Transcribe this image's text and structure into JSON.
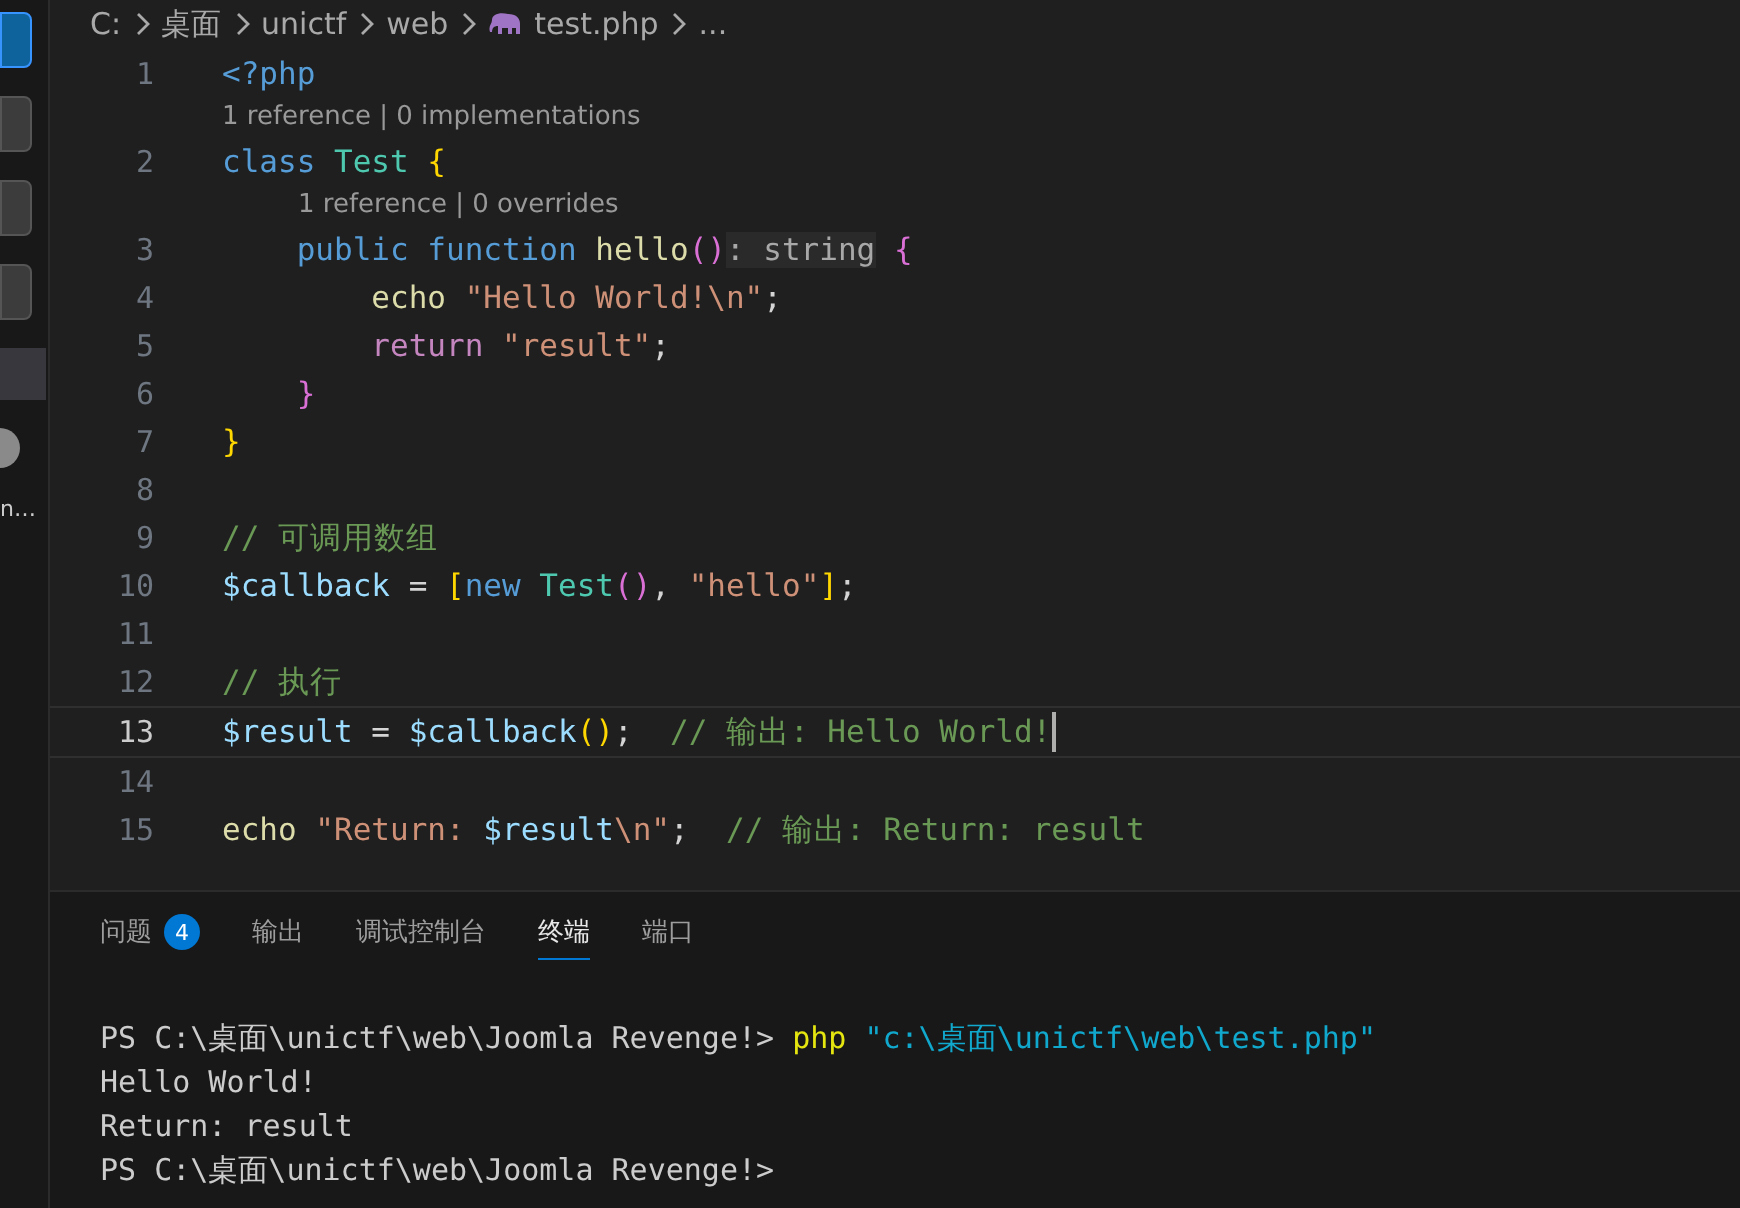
{
  "activity_bar": {
    "items": [
      {
        "kind": "icon",
        "selected": true
      },
      {
        "kind": "icon",
        "selected": false
      },
      {
        "kind": "icon",
        "selected": false
      },
      {
        "kind": "icon",
        "selected": false
      },
      {
        "kind": "highlight",
        "selected": true
      },
      {
        "kind": "dot",
        "selected": false
      }
    ],
    "cut_label": "n…"
  },
  "breadcrumb": [
    "C:",
    "桌面",
    "unictf",
    "web",
    "test.php",
    "..."
  ],
  "editor": {
    "lines": [
      {
        "number": "1",
        "current": false,
        "tokens": [
          {
            "text": "<?php",
            "kind": "keyword"
          }
        ]
      },
      {
        "number": "2",
        "current": false,
        "lens": "1 reference | 0 implementations",
        "tokens": [
          {
            "text": "class ",
            "kind": "keyword"
          },
          {
            "text": "Test ",
            "kind": "type"
          },
          {
            "text": "{",
            "kind": "bracket1"
          }
        ]
      },
      {
        "number": "3",
        "current": false,
        "lens": "1 reference | 0 overrides",
        "tokens": [
          {
            "text": "    public function ",
            "kind": "keyword"
          },
          {
            "text": "hello",
            "kind": "function"
          },
          {
            "text": "()",
            "kind": "bracket2"
          },
          {
            "text": ": string",
            "kind": "hint"
          },
          {
            "text": " {",
            "kind": "bracket2"
          }
        ]
      },
      {
        "number": "4",
        "current": false,
        "tokens": [
          {
            "text": "        echo ",
            "kind": "function"
          },
          {
            "text": "\"Hello World!\\n\"",
            "kind": "string"
          },
          {
            "text": ";",
            "kind": "plain"
          }
        ]
      },
      {
        "number": "5",
        "current": false,
        "tokens": [
          {
            "text": "        return ",
            "kind": "control"
          },
          {
            "text": "\"result\"",
            "kind": "string"
          },
          {
            "text": ";",
            "kind": "plain"
          }
        ]
      },
      {
        "number": "6",
        "current": false,
        "tokens": [
          {
            "text": "    }",
            "kind": "bracket2"
          }
        ]
      },
      {
        "number": "7",
        "current": false,
        "tokens": [
          {
            "text": "}",
            "kind": "bracket1"
          }
        ]
      },
      {
        "number": "8",
        "current": false
      },
      {
        "number": "9",
        "current": false,
        "tokens": [
          {
            "text": "// 可调用数组",
            "kind": "comment"
          }
        ]
      },
      {
        "number": "10",
        "current": false,
        "tokens": [
          {
            "text": "$callback",
            "kind": "variable"
          },
          {
            "text": " = ",
            "kind": "plain"
          },
          {
            "text": "[",
            "kind": "bracket1"
          },
          {
            "text": "new ",
            "kind": "keyword"
          },
          {
            "text": "Test",
            "kind": "type"
          },
          {
            "text": "()",
            "kind": "bracket2"
          },
          {
            "text": ", ",
            "kind": "plain"
          },
          {
            "text": "\"hello\"",
            "kind": "string"
          },
          {
            "text": "]",
            "kind": "bracket1"
          },
          {
            "text": ";",
            "kind": "plain"
          }
        ]
      },
      {
        "number": "11",
        "current": false
      },
      {
        "number": "12",
        "current": false,
        "tokens": [
          {
            "text": "// 执行",
            "kind": "comment"
          }
        ]
      },
      {
        "number": "13",
        "current": true,
        "tokens": [
          {
            "text": "$result",
            "kind": "variable"
          },
          {
            "text": " = ",
            "kind": "plain"
          },
          {
            "text": "$callback",
            "kind": "variable"
          },
          {
            "text": "()",
            "kind": "bracket1"
          },
          {
            "text": ";  ",
            "kind": "plain"
          },
          {
            "text": "// 输出: Hello World!",
            "kind": "comment"
          }
        ]
      },
      {
        "number": "14",
        "current": false
      },
      {
        "number": "15",
        "current": false,
        "tokens": [
          {
            "text": "echo ",
            "kind": "function"
          },
          {
            "text": "\"Return: ",
            "kind": "string"
          },
          {
            "text": "$result",
            "kind": "variable"
          },
          {
            "text": "\\n\"",
            "kind": "string"
          },
          {
            "text": ";  ",
            "kind": "plain"
          },
          {
            "text": "// 输出: Return: result",
            "kind": "comment"
          }
        ]
      }
    ]
  },
  "panel": {
    "tabs": [
      {
        "label": "问题",
        "badge": "4",
        "selected": false
      },
      {
        "label": "输出",
        "selected": false
      },
      {
        "label": "调试控制台",
        "selected": false
      },
      {
        "label": "终端",
        "selected": true
      },
      {
        "label": "端口",
        "selected": false
      }
    ],
    "terminal": [
      [
        {
          "text": "PS C:\\桌面\\unictf\\web\\Joomla Revenge!> ",
          "kind": "plain"
        },
        {
          "text": "php ",
          "kind": "command"
        },
        {
          "text": "\"c:\\桌面\\unictf\\web\\test.php\"",
          "kind": "argument"
        }
      ],
      [
        {
          "text": "Hello World!",
          "kind": "plain"
        }
      ],
      [
        {
          "text": "Return: result",
          "kind": "plain"
        }
      ],
      [
        {
          "text": "PS C:\\桌面\\unictf\\web\\Joomla Revenge!>",
          "kind": "plain"
        }
      ]
    ]
  }
}
